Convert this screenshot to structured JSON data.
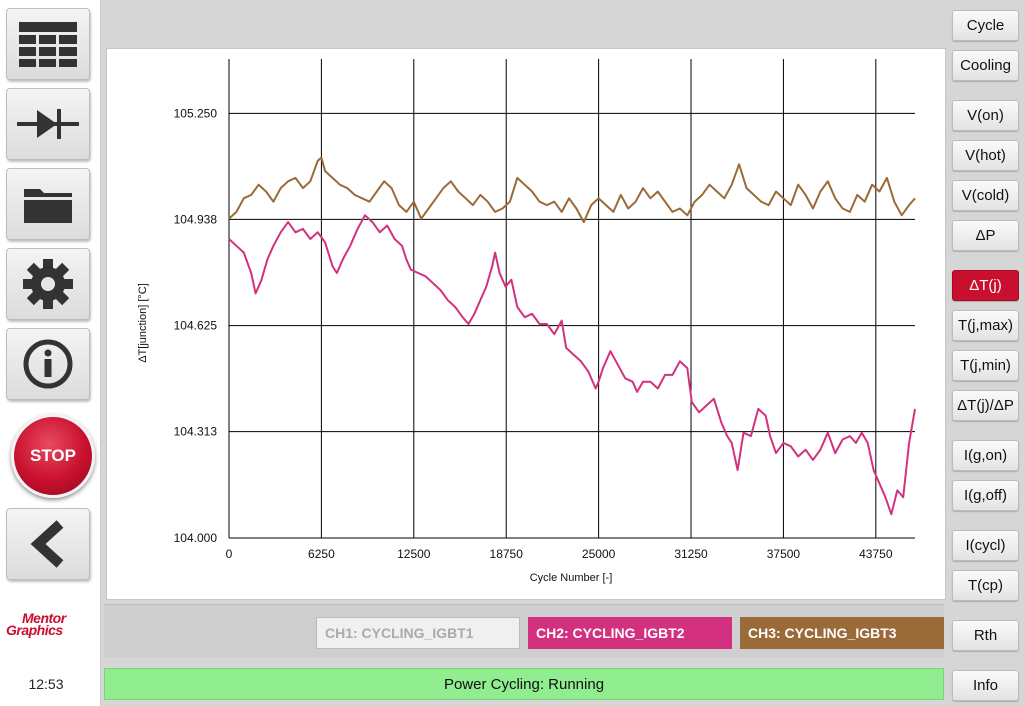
{
  "sidebar": {
    "icons": [
      "grid-table-icon",
      "diode-icon",
      "folder-icon",
      "gear-icon",
      "info-icon",
      "back-chevron-icon"
    ],
    "stop_label": "STOP",
    "logo_line1": "Mentor",
    "logo_line2": "Graphics",
    "clock": "12:53"
  },
  "right_buttons": [
    {
      "label": "Cycle",
      "active": false
    },
    {
      "label": "Cooling",
      "active": false
    },
    {
      "label": "V(on)",
      "active": false
    },
    {
      "label": "V(hot)",
      "active": false
    },
    {
      "label": "V(cold)",
      "active": false
    },
    {
      "label": "ΔP",
      "active": false
    },
    {
      "label": "ΔT(j)",
      "active": true
    },
    {
      "label": "T(j,max)",
      "active": false
    },
    {
      "label": "T(j,min)",
      "active": false
    },
    {
      "label": "ΔT(j)/ΔP",
      "active": false
    },
    {
      "label": "I(g,on)",
      "active": false
    },
    {
      "label": "I(g,off)",
      "active": false
    },
    {
      "label": "I(cycl)",
      "active": false
    },
    {
      "label": "T(cp)",
      "active": false
    },
    {
      "label": "Rth",
      "active": false
    },
    {
      "label": "Info",
      "active": false
    }
  ],
  "channels": [
    {
      "label": "CH1: CYCLING_IGBT1",
      "color": "#f0f0f0",
      "text_color": "#aaaaaa"
    },
    {
      "label": "CH2: CYCLING_IGBT2",
      "color": "#d3317f",
      "text_color": "#ffffff"
    },
    {
      "label": "CH3: CYCLING_IGBT3",
      "color": "#9a6a38",
      "text_color": "#ffffff"
    }
  ],
  "status": "Power Cycling: Running",
  "colors": {
    "accent_red": "#c8102e",
    "ch2": "#d3317f",
    "ch3": "#9a6a38",
    "status_green": "#90ee90"
  },
  "chart_data": {
    "type": "line",
    "title": "",
    "xlabel": "Cycle Number [-]",
    "ylabel": "ΔT[junction] [°C]",
    "xlim": [
      0,
      46400
    ],
    "ylim": [
      104.0,
      105.41
    ],
    "x_ticks": [
      0,
      6250,
      12500,
      18750,
      25000,
      31250,
      37500,
      43750
    ],
    "x_tick_labels": [
      "0",
      "6250",
      "12500",
      "18750",
      "25000",
      "31250",
      "37500",
      "43750"
    ],
    "y_ticks": [
      104.0,
      104.313,
      104.625,
      104.938,
      105.25
    ],
    "y_tick_labels": [
      "104.000",
      "104.313",
      "104.625",
      "104.938",
      "105.250"
    ],
    "grid": true,
    "series": [
      {
        "name": "CH3: CYCLING_IGBT3",
        "color": "#9a6a38",
        "x": [
          0,
          500,
          1000,
          1500,
          2000,
          2500,
          3000,
          3500,
          4000,
          4500,
          5000,
          5500,
          6000,
          6250,
          6500,
          7000,
          7500,
          8000,
          8500,
          9000,
          9500,
          10000,
          10500,
          11000,
          11500,
          12000,
          12500,
          13000,
          13500,
          14000,
          14500,
          15000,
          15500,
          16000,
          16500,
          17000,
          17500,
          18000,
          18500,
          19000,
          19500,
          20000,
          20500,
          21000,
          21500,
          22000,
          22500,
          23000,
          23500,
          24000,
          24500,
          25000,
          25500,
          26000,
          26500,
          27000,
          27500,
          28000,
          28500,
          29000,
          29500,
          30000,
          30500,
          31000,
          31500,
          32000,
          32500,
          33000,
          33500,
          34000,
          34500,
          35000,
          35500,
          36000,
          36500,
          37000,
          37500,
          38000,
          38500,
          39000,
          39500,
          40000,
          40500,
          41000,
          41500,
          42000,
          42500,
          43000,
          43500,
          44000,
          44500,
          45000,
          45500,
          46000,
          46400
        ],
        "y": [
          104.94,
          104.96,
          105.0,
          105.01,
          105.04,
          105.02,
          104.99,
          105.03,
          105.05,
          105.06,
          105.03,
          105.05,
          105.11,
          105.12,
          105.08,
          105.06,
          105.04,
          105.03,
          105.01,
          105.0,
          104.99,
          105.02,
          105.05,
          105.03,
          104.98,
          104.96,
          104.99,
          104.94,
          104.97,
          105.0,
          105.03,
          105.05,
          105.02,
          105.0,
          104.98,
          105.01,
          104.99,
          104.96,
          104.97,
          104.99,
          105.06,
          105.04,
          105.02,
          104.99,
          104.98,
          104.99,
          104.96,
          105.0,
          104.97,
          104.93,
          104.98,
          105.0,
          104.98,
          104.96,
          105.01,
          104.97,
          104.99,
          105.03,
          105.0,
          105.02,
          104.99,
          104.96,
          104.97,
          104.95,
          104.99,
          105.01,
          105.04,
          105.02,
          105.0,
          105.04,
          105.1,
          105.03,
          105.01,
          104.99,
          104.98,
          105.02,
          105.0,
          104.98,
          105.04,
          105.01,
          104.97,
          105.02,
          105.05,
          105.0,
          104.97,
          104.96,
          105.01,
          104.99,
          105.04,
          105.02,
          105.06,
          104.99,
          104.95,
          104.98,
          105.0
        ]
      },
      {
        "name": "CH2: CYCLING_IGBT2",
        "color": "#d3317f",
        "x": [
          0,
          500,
          1000,
          1500,
          1800,
          2200,
          2600,
          3000,
          3500,
          4000,
          4500,
          5000,
          5500,
          6000,
          6500,
          7000,
          7300,
          7700,
          8200,
          8700,
          9200,
          9700,
          10200,
          10700,
          11200,
          11700,
          12000,
          12300,
          12800,
          13300,
          13800,
          14300,
          14800,
          15300,
          15800,
          16200,
          16600,
          17000,
          17400,
          17800,
          18000,
          18300,
          18700,
          19100,
          19500,
          20000,
          20500,
          21000,
          21500,
          22000,
          22500,
          22800,
          23300,
          23800,
          24300,
          24800,
          25000,
          25300,
          25800,
          26300,
          26800,
          27300,
          27600,
          28000,
          28500,
          29000,
          29500,
          30000,
          30500,
          31000,
          31300,
          31800,
          32300,
          32800,
          33300,
          33700,
          34000,
          34400,
          34800,
          35300,
          35800,
          36300,
          36600,
          37000,
          37500,
          38000,
          38500,
          39000,
          39500,
          40000,
          40500,
          41000,
          41500,
          42000,
          42400,
          42800,
          43200,
          43600,
          44000,
          44400,
          44800,
          45200,
          45600,
          46000,
          46400
        ],
        "y": [
          104.88,
          104.86,
          104.84,
          104.78,
          104.72,
          104.76,
          104.82,
          104.86,
          104.9,
          104.93,
          104.9,
          104.91,
          104.88,
          104.9,
          104.87,
          104.8,
          104.78,
          104.82,
          104.86,
          104.91,
          104.95,
          104.93,
          104.9,
          104.92,
          104.88,
          104.86,
          104.82,
          104.79,
          104.78,
          104.77,
          104.75,
          104.73,
          104.7,
          104.68,
          104.65,
          104.63,
          104.66,
          104.7,
          104.74,
          104.8,
          104.84,
          104.78,
          104.74,
          104.76,
          104.68,
          104.65,
          104.66,
          104.63,
          104.63,
          104.6,
          104.64,
          104.56,
          104.54,
          104.52,
          104.49,
          104.44,
          104.46,
          104.5,
          104.55,
          104.51,
          104.47,
          104.46,
          104.43,
          104.46,
          104.46,
          104.44,
          104.48,
          104.48,
          104.52,
          104.5,
          104.4,
          104.37,
          104.39,
          104.41,
          104.34,
          104.3,
          104.28,
          104.2,
          104.31,
          104.3,
          104.38,
          104.36,
          104.3,
          104.25,
          104.28,
          104.27,
          104.24,
          104.26,
          104.23,
          104.26,
          104.31,
          104.25,
          104.29,
          104.3,
          104.28,
          104.31,
          104.28,
          104.2,
          104.16,
          104.12,
          104.07,
          104.14,
          104.12,
          104.28,
          104.38
        ]
      }
    ]
  }
}
